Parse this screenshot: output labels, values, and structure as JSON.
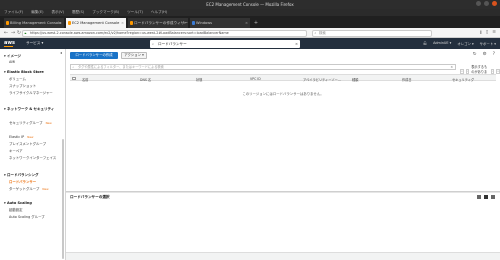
{
  "window": {
    "title": "EC2 Management Console — Mozilla Firefox"
  },
  "menu": [
    "ファイル(F)",
    "編集(E)",
    "表示(V)",
    "履歴(S)",
    "ブックマーク(B)",
    "ツール(T)",
    "ヘルプ(H)"
  ],
  "tabs": [
    {
      "label": "Billing Management Console",
      "active": false
    },
    {
      "label": "EC2 Management Console",
      "active": true
    },
    {
      "label": "ロードバランサーの作成ウィザー",
      "active": false
    },
    {
      "label": "Windows",
      "active": false
    }
  ],
  "nav": {
    "url": "https://us-west-2.console.aws.amazon.com/ec2/v2/home?region=us-west-2#LoadBalancers:sort=loadBalancerName",
    "search_placeholder": "検索"
  },
  "aws_header": {
    "logo": "aws",
    "services_label": "サービス ▾",
    "search_value": "ロードバランサー",
    "account": "AdminUE ▾",
    "region": "オレゴン ▾",
    "support": "サポート ▾"
  },
  "sidebar": {
    "sections": [
      {
        "title": "▾ イメージ",
        "items": [
          "AMI"
        ]
      },
      {
        "title": "▾ Elastic Block Store",
        "items": [
          "ボリューム",
          "スナップショット",
          "ライフサイクルマネージャー"
        ]
      },
      {
        "title": "▾ ネットワーク & セキュリティ",
        "items": [
          "セキュリティグループ",
          "Elastic IP",
          "プレイスメントグループ",
          "キーペア",
          "ネットワークインターフェイス"
        ]
      },
      {
        "title": "▾ ロードバランシング",
        "items": [
          "ロードバランサー",
          "ターゲットグループ"
        ]
      },
      {
        "title": "▾ Auto Scaling",
        "items": [
          "起動設定",
          "Auto Scaling グループ"
        ]
      }
    ],
    "new_badge": "New",
    "active_item": "ロードバランサー"
  },
  "main": {
    "create_button": "ロードバランサーの作成",
    "actions_button": "アクション ▾",
    "filter_placeholder": "タグや属性によるフィルター、またはキーワードによる検索",
    "pager": "表示するものがありません",
    "columns": [
      "名前",
      "DNS 名",
      "状態",
      "VPC ID",
      "アベイラビリティーゾー...",
      "種類",
      "作成日",
      "セキュリティグ"
    ],
    "empty_message": "このリージョンにはロードバランサーはありません。",
    "detail_title": "ロードバランサーの選択"
  }
}
